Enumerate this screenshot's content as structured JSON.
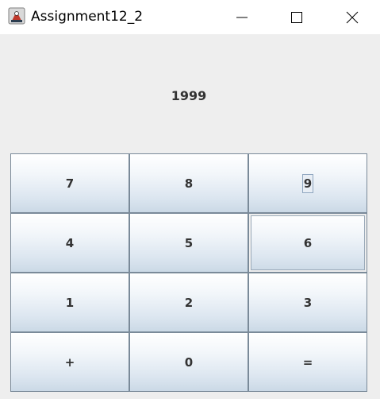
{
  "window": {
    "title": "Assignment12_2",
    "icon": "java-app-icon"
  },
  "controls": {
    "minimize_icon": "minimize-icon",
    "maximize_icon": "maximize-icon",
    "close_icon": "close-icon"
  },
  "display": {
    "value": "1999"
  },
  "keypad": {
    "keys": [
      {
        "label": "7"
      },
      {
        "label": "8"
      },
      {
        "label": "9"
      },
      {
        "label": "4"
      },
      {
        "label": "5"
      },
      {
        "label": "6"
      },
      {
        "label": "1"
      },
      {
        "label": "2"
      },
      {
        "label": "3"
      },
      {
        "label": "+"
      },
      {
        "label": "0"
      },
      {
        "label": "="
      }
    ]
  },
  "colors": {
    "button_top": "#ffffff",
    "button_bottom": "#cbd9e6",
    "button_border": "#7a8a99",
    "window_bg": "#eeeeee",
    "text": "#333333"
  }
}
